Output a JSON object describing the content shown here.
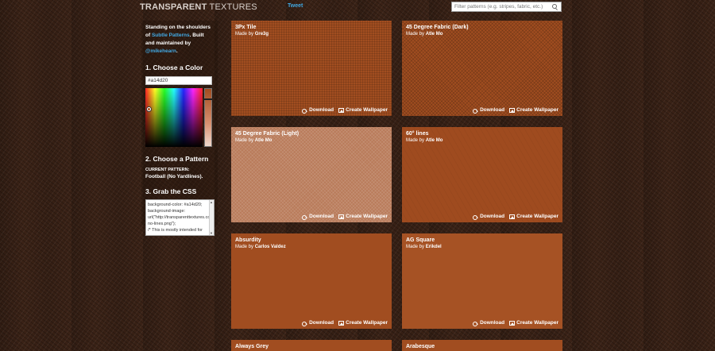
{
  "header": {
    "logo_bold": "TRANSPARENT",
    "logo_light": " TEXTURES",
    "tweet": "Tweet",
    "search_placeholder": "Filter patterns (e.g. stripes, fabric, etc.)"
  },
  "sidebar": {
    "intro_1": "Standing on the shoulders of ",
    "intro_link_1": "Subtle Patterns",
    "intro_2": ". Built and maintained by ",
    "intro_link_2": "@mikehearn",
    "intro_3": ".",
    "step1_title": "1. Choose a Color",
    "color_value": "#a14d20",
    "step2_title": "2. Choose a Pattern",
    "current_label": "CURRENT PATTERN:",
    "current_pattern": "Football (No Yardlines).",
    "step3_title": "3. Grab the CSS",
    "css_text": "background-color: #a14d20;\nbackground-image: url(\"http://transparenttextures.com/patterns/football-no-lines.png\");\n/* This is mostly intended for"
  },
  "actions": {
    "download": "Download",
    "wallpaper": "Create Wallpaper"
  },
  "tiles": [
    {
      "title": "3Px Tile",
      "made_by": "Made by ",
      "author": "Gre3g"
    },
    {
      "title": "45 Degree Fabric (Dark)",
      "made_by": "Made by ",
      "author": "Atle Mo"
    },
    {
      "title": "45 Degree Fabric (Light)",
      "made_by": "Made by ",
      "author": "Atle Mo"
    },
    {
      "title": "60° lines",
      "made_by": "Made by ",
      "author": "Atle Mo"
    },
    {
      "title": "Absurdity",
      "made_by": "Made by ",
      "author": "Carlos Valdez"
    },
    {
      "title": "AG Square",
      "made_by": "Made by ",
      "author": "Erikdel"
    },
    {
      "title": "Always Grey",
      "made_by": "",
      "author": ""
    },
    {
      "title": "Arabesque",
      "made_by": "",
      "author": ""
    }
  ],
  "colors": {
    "selected": "#a14d20",
    "link": "#42a9e3"
  }
}
